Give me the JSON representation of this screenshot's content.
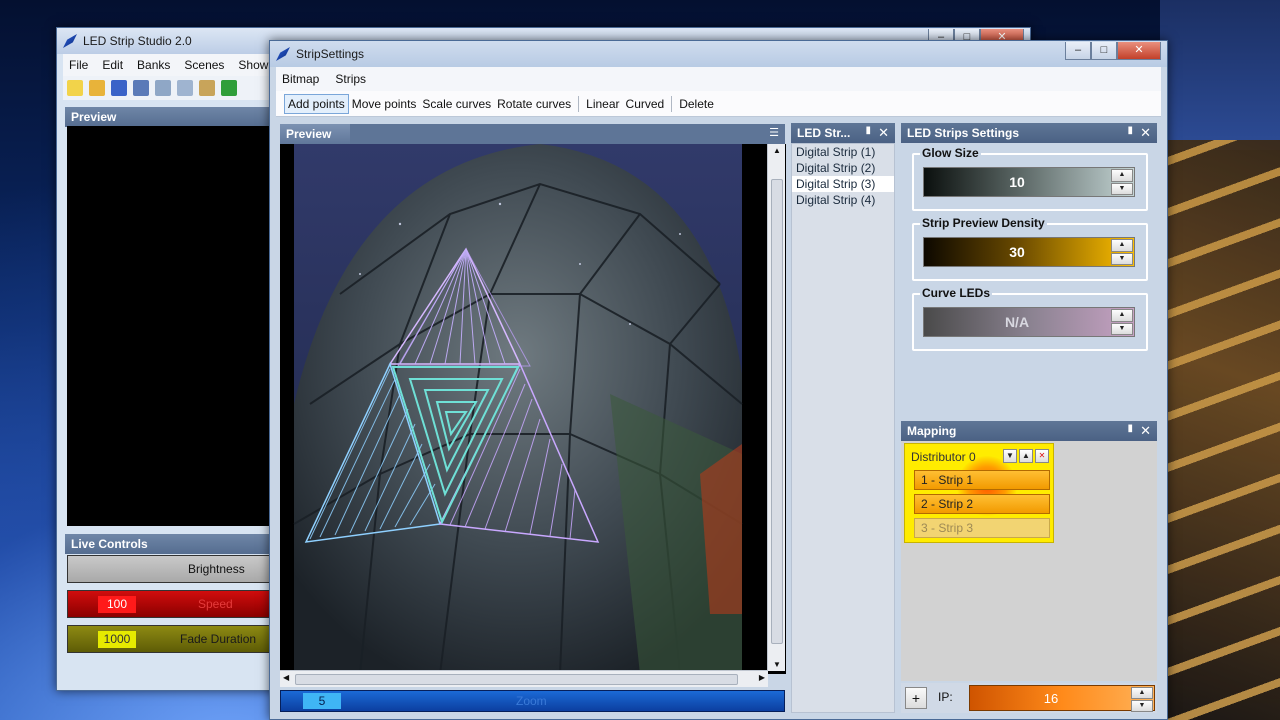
{
  "studio": {
    "title": "LED Strip Studio 2.0",
    "menu": [
      "File",
      "Edit",
      "Banks",
      "Scenes",
      "Shows"
    ],
    "preview_title": "Preview",
    "live_controls_title": "Live Controls",
    "brightness_label": "Brightness",
    "speed": {
      "value": "100",
      "label": "Speed"
    },
    "fade": {
      "value": "1000",
      "label": "Fade Duration"
    }
  },
  "window": {
    "title": "StripSettings",
    "minimize": "–",
    "maximize": "□",
    "close": "✕"
  },
  "menu": [
    "Bitmap",
    "Strips"
  ],
  "toolbar": {
    "add_points": "Add points",
    "move_points": "Move points",
    "scale_curves": "Scale curves",
    "rotate_curves": "Rotate curves",
    "linear": "Linear",
    "curved": "Curved",
    "delete": "Delete"
  },
  "preview": {
    "tab_label": "Preview",
    "zoom": {
      "value": "5",
      "label": "Zoom"
    }
  },
  "led_strips": {
    "title": "LED Str...",
    "items": [
      "Digital Strip (1)",
      "Digital Strip (2)",
      "Digital Strip (3)",
      "Digital Strip (4)"
    ],
    "selected_index": 2
  },
  "settings": {
    "title": "LED Strips Settings",
    "glow_size": {
      "label": "Glow Size",
      "value": "10"
    },
    "density": {
      "label": "Strip Preview Density",
      "value": "30"
    },
    "curve_leds": {
      "label": "Curve LEDs",
      "value": "N/A"
    }
  },
  "mapping": {
    "title": "Mapping",
    "distributor": "Distributor 0",
    "items": [
      "1 - Strip 1",
      "2 - Strip 2",
      "3 - Strip 3"
    ],
    "add_label": "+",
    "ip_label": "IP:",
    "ip_value": "16"
  },
  "colors": {
    "accent_blue": "#1b6ad6",
    "mapping_yellow": "#ffec00",
    "strip_orange": "#f29a00",
    "ip_orange": "#ff8a1a"
  }
}
